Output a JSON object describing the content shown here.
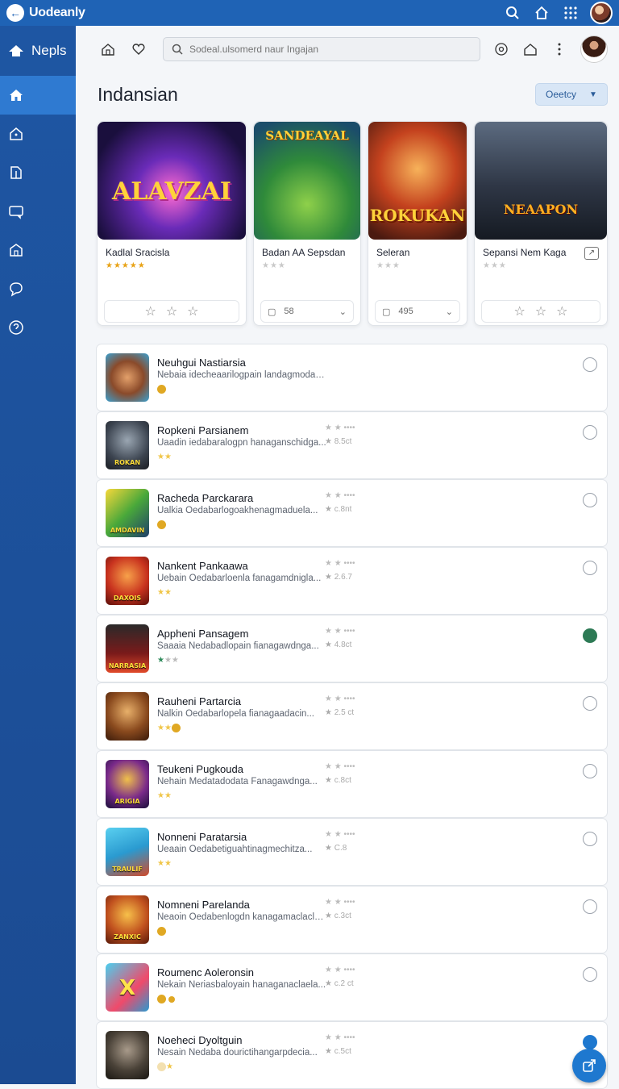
{
  "topbar": {
    "title": "Uodeanly"
  },
  "sidebar": {
    "brand": "Nepls"
  },
  "toolbar": {
    "search_placeholder": "Sodeal.ulsomerd naur Ingajan"
  },
  "page": {
    "title": "Indansian",
    "filter_label": "Oeetcy"
  },
  "featured": [
    {
      "art_text": "ALAVZAI",
      "title": "Kadlal Sracisla",
      "stars": "★★★★★",
      "footer": ""
    },
    {
      "art_text": "SANDEAYAL",
      "title": "Badan AA Sepsdan",
      "stars": "★★★",
      "footer": "58"
    },
    {
      "art_text": "ROKUKAN",
      "title": "Seleran",
      "stars": "★★★",
      "footer": "495"
    },
    {
      "art_text": "NEAAPON",
      "title": "Sepansi Nem Kaga",
      "stars": "★★★",
      "footer": ""
    }
  ],
  "list": [
    {
      "title": "Neuhgui Nastiarsia",
      "desc": "Nebaia idecheaarilogpain landagmodaain...",
      "rating": "",
      "sub": "",
      "thumb_text": ""
    },
    {
      "title": "Ropkeni Parsianem",
      "desc": "Uaadin iedabaralogpn hanaganschidga...",
      "rating": "★ ★ ••••",
      "sub": "★ 8.5ct",
      "thumb_text": "ROKAN"
    },
    {
      "title": "Racheda Parckarara",
      "desc": "Ualkia Oedabarlogoakhenagmaduela...",
      "rating": "★ ★ ••••",
      "sub": "★ c.8nt",
      "thumb_text": "AMDAVIN"
    },
    {
      "title": "Nankent Pankaawa",
      "desc": "Uebain Oedabarloenla fanagamdnigla...",
      "rating": "★ ★ ••••",
      "sub": "★ 2.6.7",
      "thumb_text": "DAXOIS"
    },
    {
      "title": "Appheni Pansagem",
      "desc": "Saaaia Nedabadlopain fianagawdnga...",
      "rating": "★ ★ ••••",
      "sub": "★ 4.8ct",
      "thumb_text": "NARRASIA"
    },
    {
      "title": "Rauheni Partarcia",
      "desc": "Nalkin Oedabarlopela fianagaadacin...",
      "rating": "★ ★ ••••",
      "sub": "★ 2.5 ct",
      "thumb_text": ""
    },
    {
      "title": "Teukeni Pugkouda",
      "desc": "Nehain Medatadodata Fanagawdnga...",
      "rating": "★ ★ ••••",
      "sub": "★ c.8ct",
      "thumb_text": "ARIGIA"
    },
    {
      "title": "Nonneni Paratarsia",
      "desc": "Ueaain Oedabetiguahtinagmechitza...",
      "rating": "★ ★ ••••",
      "sub": "★ C.8",
      "thumb_text": "TRAULIF"
    },
    {
      "title": "Nomneni Parelanda",
      "desc": "Neaoin Oedabenlogdn kanagamaclacla...",
      "rating": "★ ★ ••••",
      "sub": "★ c.3ct",
      "thumb_text": "ZANXIC"
    },
    {
      "title": "Roumenc Aoleronsin",
      "desc": "Nekain Neriasbaloyain hanaganaclaela...",
      "rating": "★ ★ ••••",
      "sub": "★ c.2 ct",
      "thumb_text": "X"
    },
    {
      "title": "Noeheci Dyoltguin",
      "desc": "Nesain Nedaba dourictihangarpdecia...",
      "rating": "★ ★ ••••",
      "sub": "★ c.5ct",
      "thumb_text": ""
    }
  ]
}
